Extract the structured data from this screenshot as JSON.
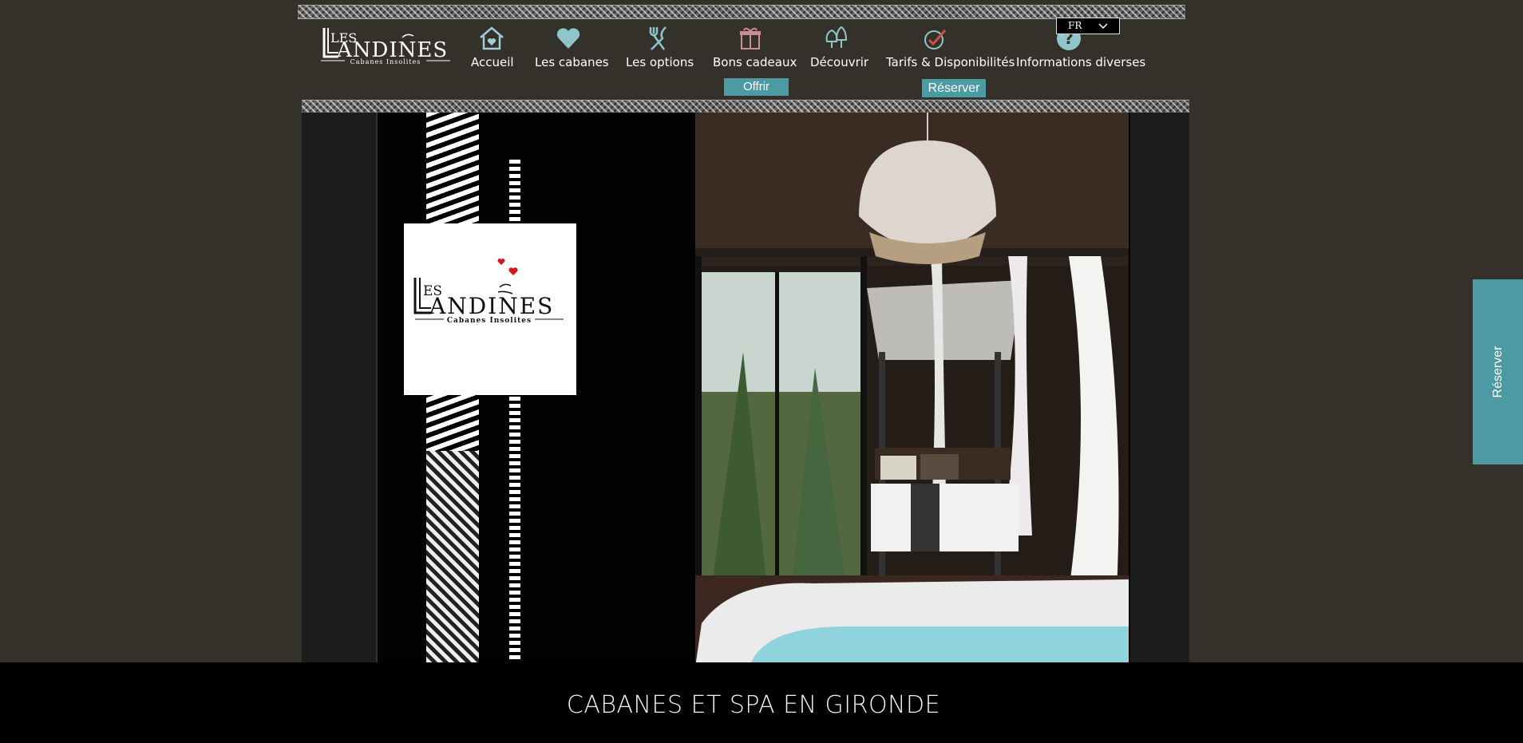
{
  "brand": {
    "name_first": "LES",
    "name_second": "ANDINES",
    "tagline": "Cabanes Insolites",
    "logo_icon": "les-landines-logo"
  },
  "nav": {
    "items": [
      {
        "label": "Accueil",
        "icon": "house-icon"
      },
      {
        "label": "Les cabanes",
        "icon": "heart-icon"
      },
      {
        "label": "Les options",
        "icon": "cutlery-icon"
      },
      {
        "label": "Bons cadeaux",
        "icon": "gift-icon"
      },
      {
        "label": "Découvrir",
        "icon": "trees-icon"
      },
      {
        "label": "Tarifs & Disponibilités",
        "icon": "checkmark-icon"
      },
      {
        "label": "Informations diverses",
        "icon": "question-icon"
      }
    ]
  },
  "actions": {
    "offrir_label": "Offrir",
    "reserver_label": "Réserver"
  },
  "language": {
    "selected": "FR"
  },
  "hero": {
    "card_logo_first": "ES",
    "card_logo_second": "ANDINES",
    "card_tagline": "Cabanes Insolites"
  },
  "footer": {
    "title": "CABANES ET SPA EN GIRONDE"
  },
  "side_tab": {
    "label": "Réserver"
  },
  "colors": {
    "background": "#34312b",
    "accent": "#4c9aa3",
    "footer": "#000000",
    "icon_tint": "#7fb9c0",
    "heart_red": "#d21a1a"
  }
}
